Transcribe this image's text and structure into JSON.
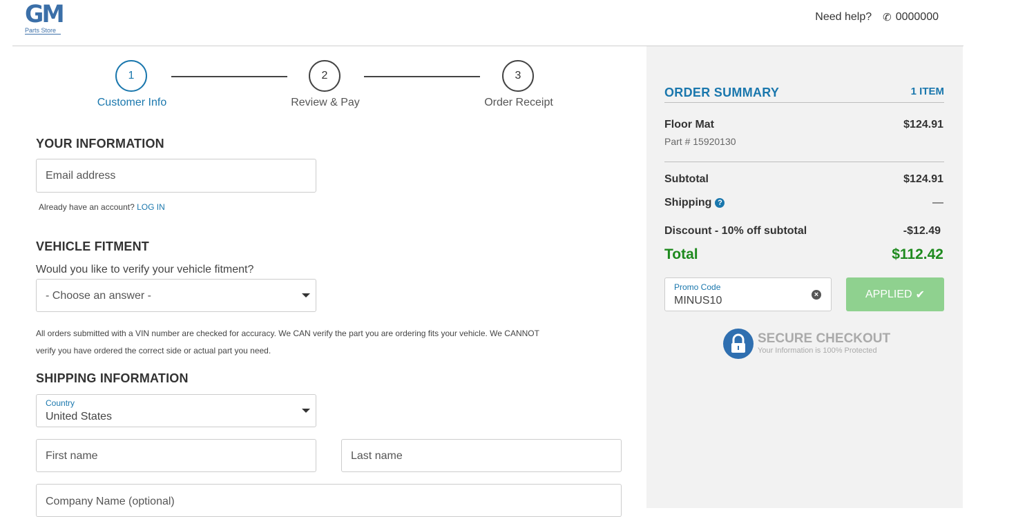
{
  "header": {
    "logo_main": "GM",
    "logo_sub": "Parts Store",
    "help_text": "Need help?",
    "phone": "0000000"
  },
  "steps": [
    {
      "number": "1",
      "label": "Customer Info"
    },
    {
      "number": "2",
      "label": "Review & Pay"
    },
    {
      "number": "3",
      "label": "Order Receipt"
    }
  ],
  "your_info": {
    "title": "YOUR INFORMATION",
    "email_placeholder": "Email address",
    "account_prompt": "Already have an account?",
    "login_link": "LOG IN"
  },
  "vehicle": {
    "title": "VEHICLE FITMENT",
    "question": "Would you like to verify your vehicle fitment?",
    "select_value": "- Choose an answer -",
    "disclaimer_line1": "All orders submitted with a VIN number are checked for accuracy. We CAN verify the part you are ordering fits your vehicle. We CANNOT",
    "disclaimer_line2": "verify you have ordered the correct side or actual part you need."
  },
  "shipping": {
    "title": "SHIPPING INFORMATION",
    "country_label": "Country",
    "country_value": "United States",
    "first_name_placeholder": "First name",
    "last_name_placeholder": "Last name",
    "company_placeholder": "Company Name (optional)"
  },
  "summary": {
    "title": "ORDER SUMMARY",
    "count": "1 ITEM",
    "item_name": "Floor Mat",
    "item_price": "$124.91",
    "part_number": "Part # 15920130",
    "subtotal_label": "Subtotal",
    "subtotal_value": "$124.91",
    "shipping_label": "Shipping",
    "shipping_value": "—",
    "discount_label": "Discount - 10% off subtotal",
    "discount_value": "-$12.49",
    "total_label": "Total",
    "total_value": "$112.42",
    "promo_label": "Promo Code",
    "promo_value": "MINUS10",
    "applied_label": "APPLIED",
    "secure_title": "SECURE CHECKOUT",
    "secure_sub": "Your Information is 100% Protected"
  },
  "colors": {
    "accent": "#1a77ad",
    "total_green": "#1e8a1e",
    "applied_green": "#8fd18f",
    "sidebar_bg": "#f2f2f2"
  }
}
